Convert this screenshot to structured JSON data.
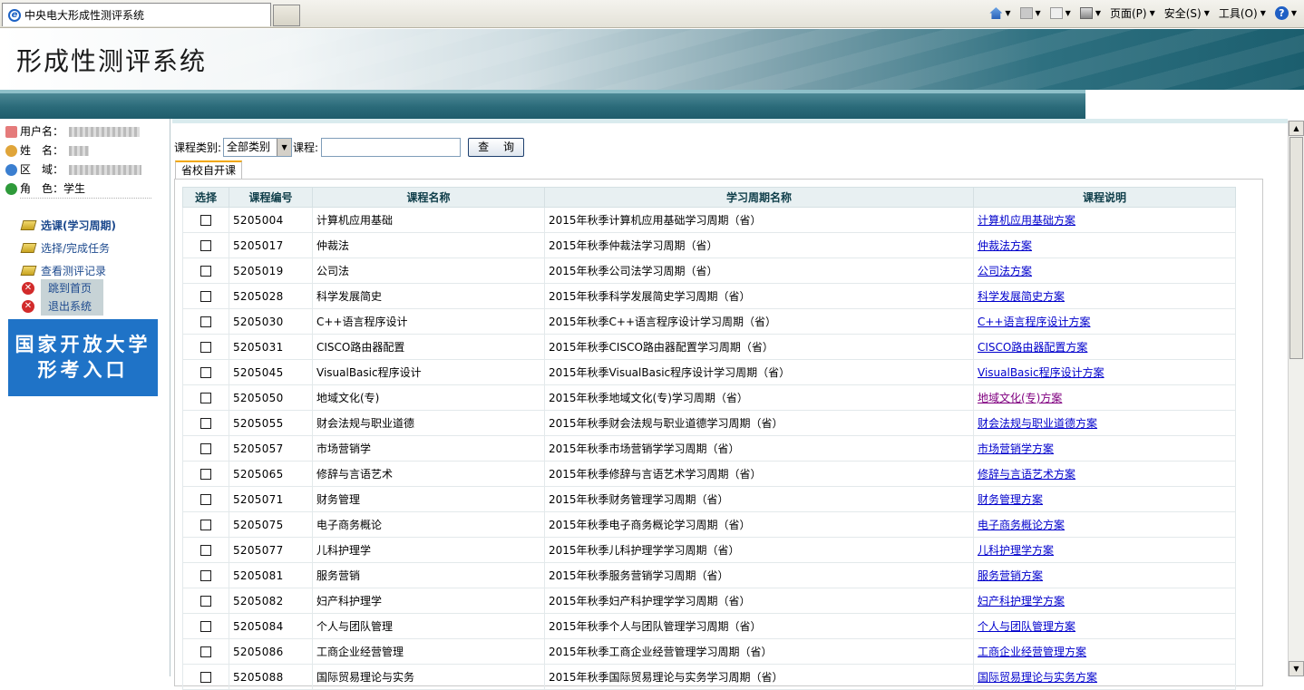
{
  "browser": {
    "tab_title": "中央电大形成性测评系统",
    "page_menu": "页面(P)",
    "safety_menu": "安全(S)",
    "tools_menu": "工具(O)"
  },
  "header": {
    "title": "形成性测评系统"
  },
  "user": {
    "username_label": "用户名：",
    "name_label": "姓　名：",
    "region_label": "区　域：",
    "role_label": "角　色：",
    "role_value": "学生"
  },
  "menu": {
    "items": [
      {
        "label": "选课(学习周期)"
      },
      {
        "label": "选择/完成任务"
      },
      {
        "label": "查看测评记录"
      }
    ],
    "home": "跳到首页",
    "logout": "退出系统",
    "entry_line1": "国家开放大学",
    "entry_line2": "形考入口"
  },
  "query": {
    "category_label": "课程类别:",
    "category_value": "全部类别",
    "course_label": "课程:",
    "button": "查 询"
  },
  "tab": "省校自开课",
  "table": {
    "headers": [
      "选择",
      "课程编号",
      "课程名称",
      "学习周期名称",
      "课程说明"
    ],
    "rows": [
      {
        "code": "5205004",
        "name": "计算机应用基础",
        "period": "2015年秋季计算机应用基础学习周期（省）",
        "plan": "计算机应用基础方案"
      },
      {
        "code": "5205017",
        "name": "仲裁法",
        "period": "2015年秋季仲裁法学习周期（省）",
        "plan": "仲裁法方案"
      },
      {
        "code": "5205019",
        "name": "公司法",
        "period": "2015年秋季公司法学习周期（省）",
        "plan": "公司法方案"
      },
      {
        "code": "5205028",
        "name": "科学发展简史",
        "period": "2015年秋季科学发展简史学习周期（省）",
        "plan": "科学发展简史方案"
      },
      {
        "code": "5205030",
        "name": "C++语言程序设计",
        "period": "2015年秋季C++语言程序设计学习周期（省）",
        "plan": "C++语言程序设计方案"
      },
      {
        "code": "5205031",
        "name": "CISCO路由器配置",
        "period": "2015年秋季CISCO路由器配置学习周期（省）",
        "plan": "CISCO路由器配置方案"
      },
      {
        "code": "5205045",
        "name": "VisualBasic程序设计",
        "period": "2015年秋季VisualBasic程序设计学习周期（省）",
        "plan": "VisualBasic程序设计方案"
      },
      {
        "code": "5205050",
        "name": "地域文化(专)",
        "period": "2015年秋季地域文化(专)学习周期（省）",
        "plan": "地域文化(专)方案"
      },
      {
        "code": "5205055",
        "name": "财会法规与职业道德",
        "period": "2015年秋季财会法规与职业道德学习周期（省）",
        "plan": "财会法规与职业道德方案"
      },
      {
        "code": "5205057",
        "name": "市场营销学",
        "period": "2015年秋季市场营销学学习周期（省）",
        "plan": "市场营销学方案"
      },
      {
        "code": "5205065",
        "name": "修辞与言语艺术",
        "period": "2015年秋季修辞与言语艺术学习周期（省）",
        "plan": "修辞与言语艺术方案"
      },
      {
        "code": "5205071",
        "name": "财务管理",
        "period": "2015年秋季财务管理学习周期（省）",
        "plan": "财务管理方案"
      },
      {
        "code": "5205075",
        "name": "电子商务概论",
        "period": "2015年秋季电子商务概论学习周期（省）",
        "plan": "电子商务概论方案"
      },
      {
        "code": "5205077",
        "name": "儿科护理学",
        "period": "2015年秋季儿科护理学学习周期（省）",
        "plan": "儿科护理学方案"
      },
      {
        "code": "5205081",
        "name": "服务营销",
        "period": "2015年秋季服务营销学习周期（省）",
        "plan": "服务营销方案"
      },
      {
        "code": "5205082",
        "name": "妇产科护理学",
        "period": "2015年秋季妇产科护理学学习周期（省）",
        "plan": "妇产科护理学方案"
      },
      {
        "code": "5205084",
        "name": "个人与团队管理",
        "period": "2015年秋季个人与团队管理学习周期（省）",
        "plan": "个人与团队管理方案"
      },
      {
        "code": "5205086",
        "name": "工商企业经营管理",
        "period": "2015年秋季工商企业经营管理学习周期（省）",
        "plan": "工商企业经营管理方案"
      },
      {
        "code": "5205088",
        "name": "国际贸易理论与实务",
        "period": "2015年秋季国际贸易理论与实务学习周期（省）",
        "plan": "国际贸易理论与实务方案"
      }
    ]
  }
}
